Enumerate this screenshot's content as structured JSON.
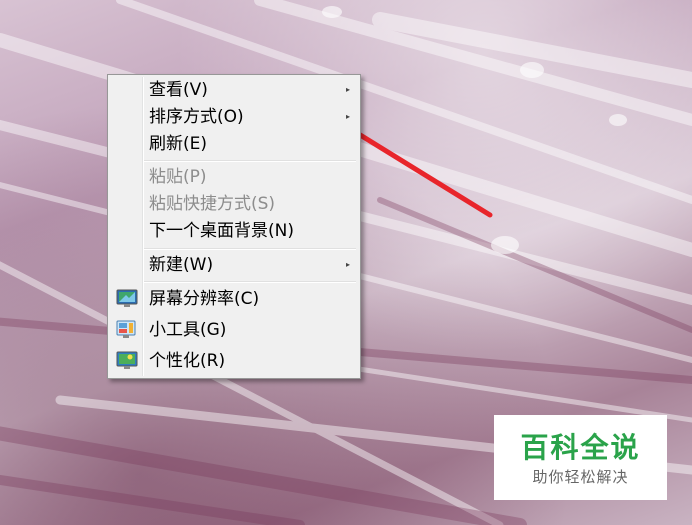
{
  "context_menu": {
    "items": [
      {
        "label": "查看(V)",
        "submenu": true,
        "enabled": true
      },
      {
        "label": "排序方式(O)",
        "submenu": true,
        "enabled": true
      },
      {
        "label": "刷新(E)",
        "submenu": false,
        "enabled": true
      },
      {
        "label": "粘贴(P)",
        "submenu": false,
        "enabled": false
      },
      {
        "label": "粘贴快捷方式(S)",
        "submenu": false,
        "enabled": false
      },
      {
        "label": "下一个桌面背景(N)",
        "submenu": false,
        "enabled": true
      },
      {
        "label": "新建(W)",
        "submenu": true,
        "enabled": true
      },
      {
        "label": "屏幕分辨率(C)",
        "submenu": false,
        "enabled": true,
        "icon": "screen-resolution-icon"
      },
      {
        "label": "小工具(G)",
        "submenu": false,
        "enabled": true,
        "icon": "gadgets-icon"
      },
      {
        "label": "个性化(R)",
        "submenu": false,
        "enabled": true,
        "icon": "personalize-icon"
      }
    ],
    "submenu_glyph": "▸"
  },
  "annotation": {
    "type": "red-arrow",
    "color": "#e8252b",
    "points_to": "查看(V)"
  },
  "watermark": {
    "title": "百科全说",
    "subtitle": "助你轻松解决",
    "color": "#2aa34a"
  }
}
